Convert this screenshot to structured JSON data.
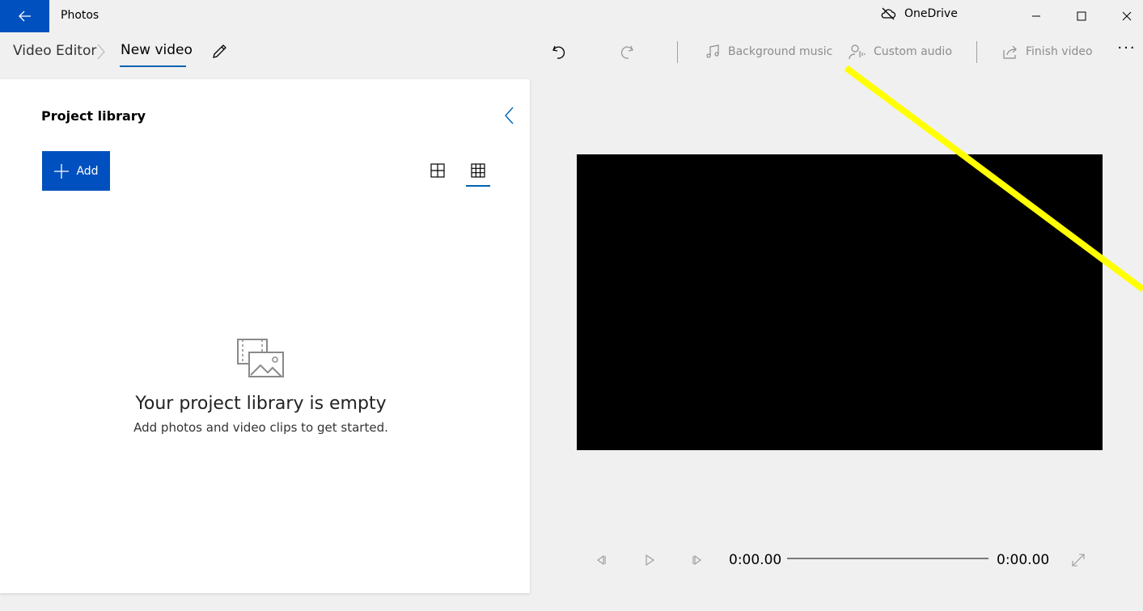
{
  "titlebar": {
    "app_title": "Photos",
    "onedrive_label": "OneDrive",
    "back_icon": "back-arrow-icon",
    "minimize_icon": "minimize-icon",
    "maximize_icon": "maximize-icon",
    "close_icon": "close-icon",
    "accent_color": "#0050bf"
  },
  "breadcrumb": {
    "root": "Video Editor",
    "current": "New video"
  },
  "toolbar": {
    "background_music": "Background music",
    "custom_audio": "Custom audio",
    "finish_video": "Finish video",
    "more": "···"
  },
  "library": {
    "title": "Project library",
    "add_label": "Add",
    "empty_title": "Your project library is empty",
    "empty_subtitle": "Add photos and video clips to get started."
  },
  "player": {
    "current_time": "0:00.00",
    "total_time": "0:00.00"
  }
}
